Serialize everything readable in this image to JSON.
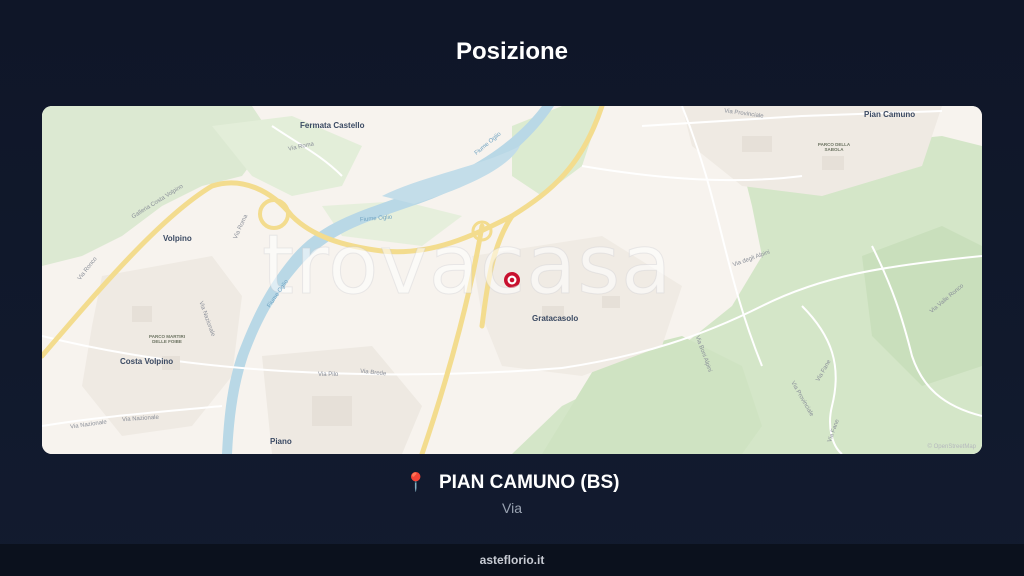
{
  "page": {
    "title": "Posizione"
  },
  "map": {
    "labels": {
      "fermata_castello": "Fermata Castello",
      "pian_camuno": "Pian Camuno",
      "volpino": "Volpino",
      "costa_volpino": "Costa Volpino",
      "gratacasolo": "Gratacasolo",
      "piano": "Piano",
      "via_roma": "Via Roma",
      "via_roma_2": "Via Roma",
      "galleria": "Galleria Costa Volpino",
      "via_provinciale": "Via Provinciale",
      "via_provinciale_2": "Via Provinciale",
      "via_pilo": "Via Pilo",
      "via_brede": "Via Brede",
      "via_nazionale": "Via Nazionale",
      "via_nazionale_2": "Via Nazionale",
      "via_nazionale_3": "Via Nazionale",
      "via_ronco": "Via Ronco",
      "fiume_oglio": "Fiume Oglio",
      "fiume_oglio_2": "Fiume Oglio",
      "fiume_oglio_3": "Fiume Oglio",
      "parco_sabola": "PARCO DELLA SABOLA",
      "parco_martiri": "PARCO MARTIRI DELLE FOIBE",
      "via_fane": "Via Fane",
      "via_fane_2": "Via Fane",
      "via_boni_alpini": "Via Boni Alpini",
      "via_degli_alpini": "Via degli Alpini",
      "via_valle_ronco": "Via Valle Ronco",
      "attribution": "© OpenStreetMap"
    },
    "watermark": "trovacasa",
    "marker_icon": "map-pin-marker"
  },
  "location": {
    "pin_icon": "round-pushpin",
    "pin_glyph": "📍",
    "name": "PIAN CAMUNO (BS)",
    "address": "Via"
  },
  "footer": {
    "site": "asteflorio.it"
  },
  "colors": {
    "background": "#0f1628",
    "map_base": "#f7f3ee",
    "forest": "#d9e8cf",
    "water": "#b9d8e6",
    "highway": "#f3dc8e",
    "marker": "#c8102e"
  }
}
